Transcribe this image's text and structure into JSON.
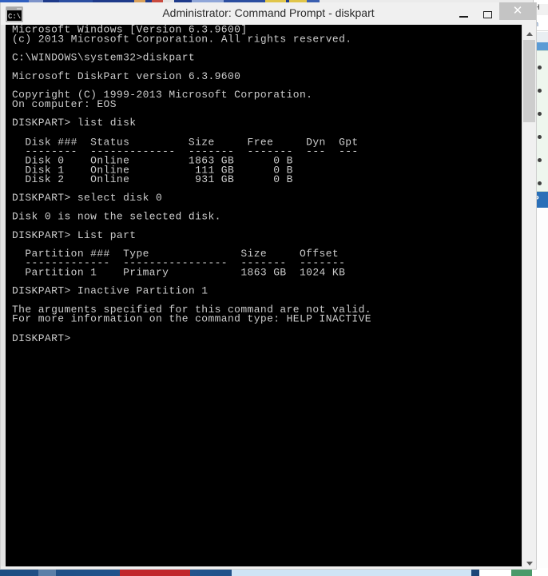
{
  "window": {
    "title": "Administrator: Command Prompt - diskpart",
    "icon": "console-icon",
    "controls": {
      "minimize": "–",
      "maximize": "❑",
      "close": "✕"
    }
  },
  "scrollbar": {
    "up_arrow": "scroll-up-arrow",
    "down_arrow": "scroll-down-arrow"
  },
  "console": {
    "text": "Microsoft Windows [Version 6.3.9600]\n(c) 2013 Microsoft Corporation. All rights reserved.\n\nC:\\WINDOWS\\system32>diskpart\n\nMicrosoft DiskPart version 6.3.9600\n\nCopyright (C) 1999-2013 Microsoft Corporation.\nOn computer: EOS\n\nDISKPART> list disk\n\n  Disk ###  Status         Size     Free     Dyn  Gpt\n  --------  -------------  -------  -------  ---  ---\n  Disk 0    Online         1863 GB      0 B\n  Disk 1    Online          111 GB      0 B\n  Disk 2    Online          931 GB      0 B\n\nDISKPART> select disk 0\n\nDisk 0 is now the selected disk.\n\nDISKPART> List part\n\n  Partition ###  Type              Size     Offset\n  -------------  ----------------  -------  -------\n  Partition 1    Primary           1863 GB  1024 KB\n\nDISKPART> Inactive Partition 1\n\nThe arguments specified for this command are not valid.\nFor more information on the command type: HELP INACTIVE\n\nDISKPART>",
    "lines": [
      "Microsoft Windows [Version 6.3.9600]",
      "(c) 2013 Microsoft Corporation. All rights reserved.",
      "C:\\WINDOWS\\system32>diskpart",
      "Microsoft DiskPart version 6.3.9600",
      "Copyright (C) 1999-2013 Microsoft Corporation.",
      "On computer: EOS",
      "DISKPART> list disk",
      "DISKPART> select disk 0",
      "Disk 0 is now the selected disk.",
      "DISKPART> List part",
      "DISKPART> Inactive Partition 1",
      "The arguments specified for this command are not valid.",
      "For more information on the command type: HELP INACTIVE",
      "DISKPART>"
    ],
    "disk_table": {
      "headers": [
        "Disk ###",
        "Status",
        "Size",
        "Free",
        "Dyn",
        "Gpt"
      ],
      "rows": [
        [
          "Disk 0",
          "Online",
          "1863 GB",
          "0 B",
          "",
          ""
        ],
        [
          "Disk 1",
          "Online",
          "111 GB",
          "0 B",
          "",
          ""
        ],
        [
          "Disk 2",
          "Online",
          "931 GB",
          "0 B",
          "",
          ""
        ]
      ]
    },
    "partition_table": {
      "headers": [
        "Partition ###",
        "Type",
        "Size",
        "Offset"
      ],
      "rows": [
        [
          "Partition 1",
          "Primary",
          "1863 GB",
          "1024 KB"
        ]
      ]
    },
    "prompt": "DISKPART>"
  },
  "background": {
    "right_window": {
      "title_text": "H",
      "url_text": "h",
      "highlight_text": "P",
      "bullet_count": 6
    },
    "tabstrip_colors": [
      "#1e3a8a",
      "#2b4ea0",
      "#c94a3f",
      "#e0c54a",
      "#3a5fb0"
    ],
    "taskbar_colors": [
      "#1e4d82",
      "#c1272d",
      "#cfe4f5"
    ]
  }
}
